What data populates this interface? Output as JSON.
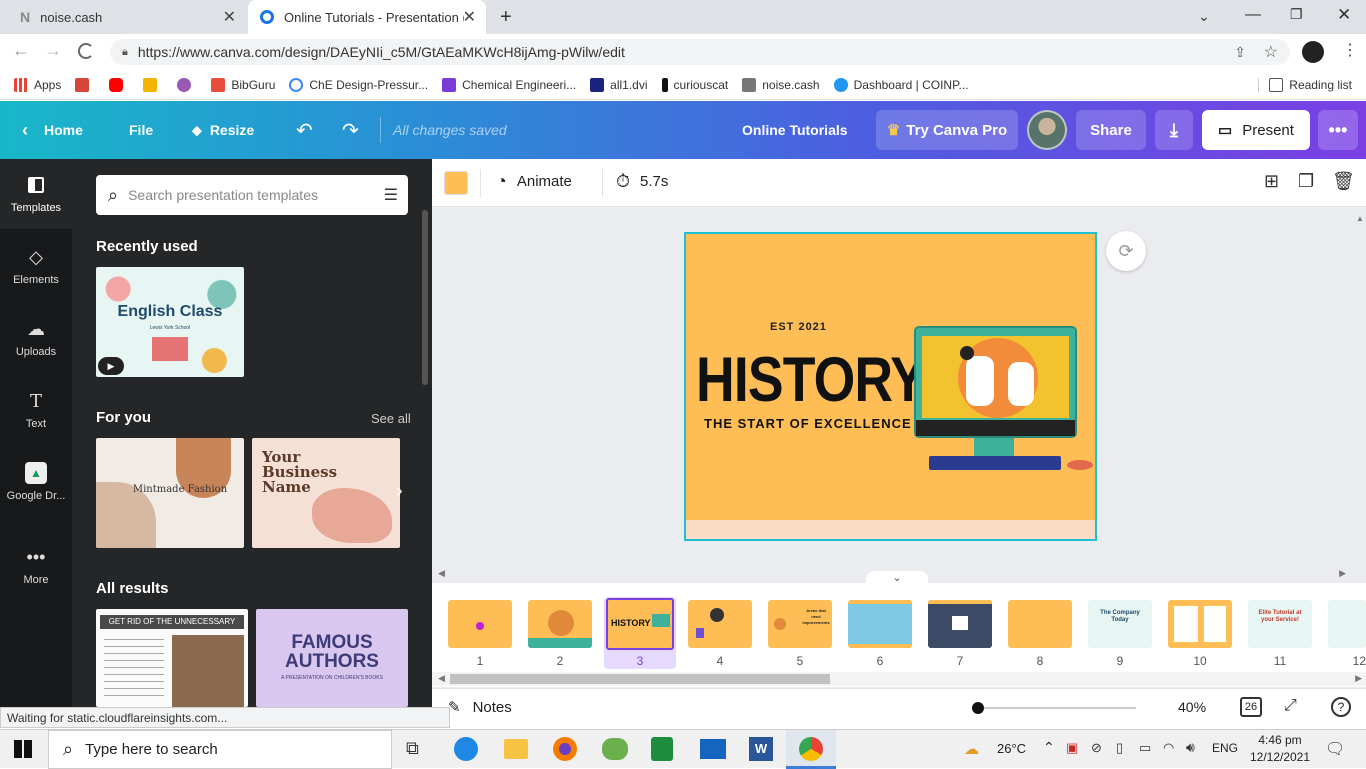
{
  "browser": {
    "tabs": [
      {
        "label": "noise.cash",
        "favicon": "N"
      },
      {
        "label": "Online Tutorials - Presentation (4...",
        "favicon": "canva"
      }
    ],
    "new_tab": "+",
    "url": "https://www.canva.com/design/DAEyNIi_c5M/GtAEaMKWcH8ijAmg-pWilw/edit",
    "bookmarks": [
      {
        "label": "Apps",
        "color": "#ea4335"
      },
      {
        "label": "",
        "color": "#d44638"
      },
      {
        "label": "",
        "color": "#ff0000"
      },
      {
        "label": "",
        "color": "#f4b400"
      },
      {
        "label": "",
        "color": "#9b59b6"
      },
      {
        "label": "BibGuru",
        "color": "#e74c3c"
      },
      {
        "label": "ChE Design-Pressur...",
        "color": "#4285f4"
      },
      {
        "label": "Chemical Engineeri...",
        "color": "#7a3cd6"
      },
      {
        "label": "all1.dvi",
        "color": "#1a237e"
      },
      {
        "label": "curiouscat",
        "color": "#111111"
      },
      {
        "label": "noise.cash",
        "color": "#777777"
      },
      {
        "label": "Dashboard | COINP...",
        "color": "#2196f3"
      }
    ],
    "reading_list": "Reading list"
  },
  "canva": {
    "home": "Home",
    "file": "File",
    "resize": "Resize",
    "saved_status": "All changes saved",
    "doc_title": "Online Tutorials",
    "try_pro": "Try Canva Pro",
    "share": "Share",
    "present": "Present"
  },
  "rail": [
    {
      "label": "Templates",
      "icon": "template-icon"
    },
    {
      "label": "Elements",
      "icon": "elements-icon"
    },
    {
      "label": "Uploads",
      "icon": "upload-icon"
    },
    {
      "label": "Text",
      "icon": "text-icon"
    },
    {
      "label": "Google Dr...",
      "icon": "drive-icon"
    },
    {
      "label": "More",
      "icon": "more-icon"
    }
  ],
  "panel": {
    "search_placeholder": "Search presentation templates",
    "recently_used": "Recently used",
    "english_title": "English Class",
    "english_sub": "Lewis York School",
    "for_you": "For you",
    "see_all": "See all",
    "mintmade": "Mintmade Fashion",
    "business": "Your Business Name",
    "all_results": "All results",
    "rid_title": "GET RID OF THE UNNECESSARY",
    "famous": "FAMOUS AUTHORS",
    "famous_sub": "A PRESENTATION ON CHILDREN'S BOOKS"
  },
  "toolbar": {
    "swatch": "#ffbe55",
    "animate": "Animate",
    "duration": "5.7s"
  },
  "slide": {
    "est": "EST 2021",
    "title": "HISTORY",
    "subtitle": "THE START OF EXCELLENCE",
    "bg": "#ffbe55"
  },
  "filmstrip": {
    "pages": [
      "1",
      "2",
      "3",
      "4",
      "5",
      "6",
      "7",
      "8",
      "9",
      "10",
      "11",
      "12"
    ],
    "selected": "3",
    "page9_text": "The Company Today",
    "page11_text": "Elite Tutorial at your Service!",
    "page5_text": "Areas that need improvements"
  },
  "bottom": {
    "notes": "Notes",
    "zoom": "40%",
    "page_count": "26",
    "help": "?"
  },
  "statusbar": "Waiting for static.cloudflareinsights.com...",
  "taskbar": {
    "search_placeholder": "Type here to search",
    "weather": "26°C",
    "lang": "ENG",
    "time": "4:46 pm",
    "date": "12/12/2021"
  }
}
